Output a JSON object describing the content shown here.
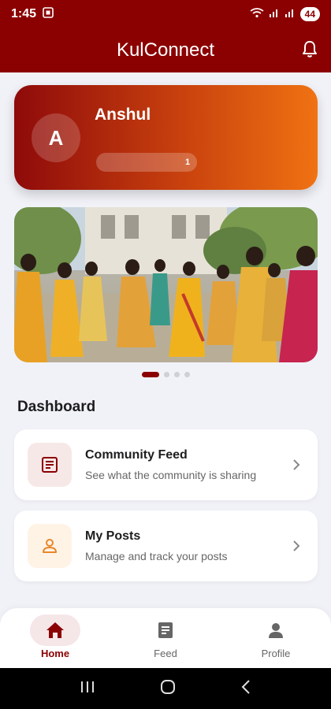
{
  "status_bar": {
    "time": "1:45",
    "battery": "44"
  },
  "app_bar": {
    "title": "KulConnect"
  },
  "profile": {
    "avatar_letter": "A",
    "name": "Anshul",
    "badge": "1"
  },
  "carousel": {
    "total_slides": 4,
    "active_index": 0
  },
  "dashboard": {
    "title": "Dashboard",
    "items": [
      {
        "title": "Community Feed",
        "subtitle": "See what the community is sharing",
        "icon": "document-icon"
      },
      {
        "title": "My Posts",
        "subtitle": "Manage and track your posts",
        "icon": "person-icon"
      }
    ]
  },
  "bottom_nav": {
    "items": [
      {
        "label": "Home",
        "icon": "home-icon",
        "active": true
      },
      {
        "label": "Feed",
        "icon": "article-icon",
        "active": false
      },
      {
        "label": "Profile",
        "icon": "person-icon",
        "active": false
      }
    ]
  },
  "colors": {
    "brand": "#8b0000",
    "gradient_end": "#f07212",
    "accent_orange": "#e8882a"
  }
}
